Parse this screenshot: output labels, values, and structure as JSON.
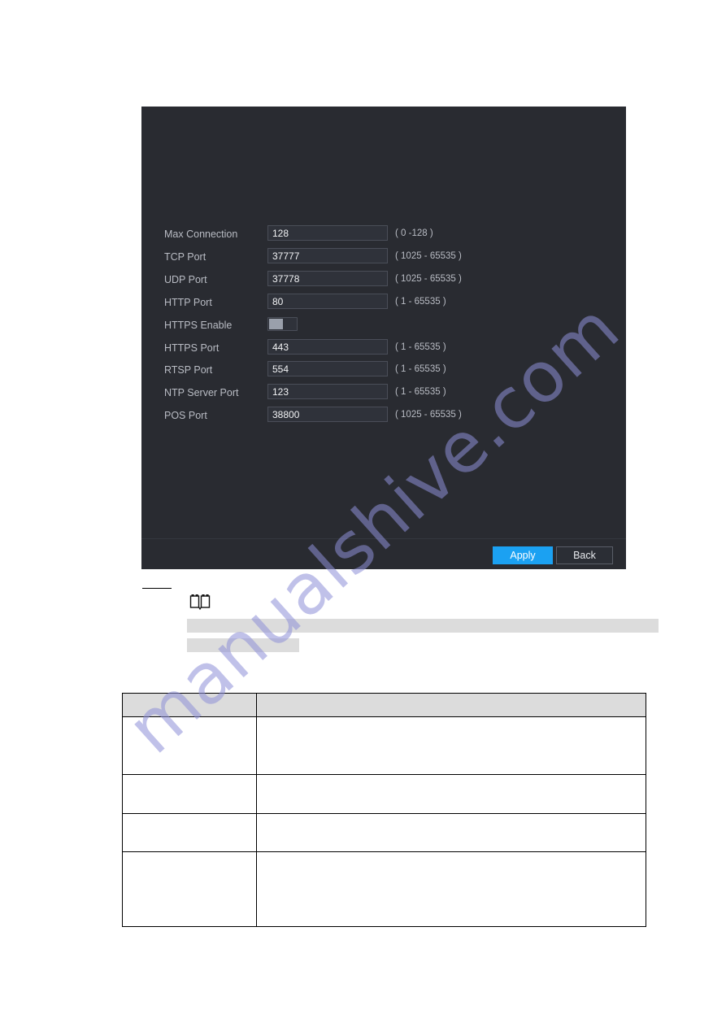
{
  "watermark": {
    "text": "manualshive.com",
    "color": "#8e90d8"
  },
  "dialog": {
    "background": "#292b31",
    "rows": [
      {
        "label": "Max Connection",
        "type": "input",
        "value": "128",
        "hint": "( 0 -128 )"
      },
      {
        "label": "TCP Port",
        "type": "input",
        "value": "37777",
        "hint": "( 1025 - 65535 )"
      },
      {
        "label": "UDP Port",
        "type": "input",
        "value": "37778",
        "hint": "( 1025 - 65535 )"
      },
      {
        "label": "HTTP Port",
        "type": "input",
        "value": "80",
        "hint": "( 1 - 65535 )"
      },
      {
        "label": "HTTPS Enable",
        "type": "toggle",
        "value": "off",
        "hint": ""
      },
      {
        "label": "HTTPS Port",
        "type": "input",
        "value": "443",
        "hint": "( 1 - 65535 )"
      },
      {
        "label": "RTSP Port",
        "type": "input",
        "value": "554",
        "hint": "( 1 - 65535 )"
      },
      {
        "label": "NTP Server Port",
        "type": "input",
        "value": "123",
        "hint": "( 1 - 65535 )"
      },
      {
        "label": "POS Port",
        "type": "input",
        "value": "38800",
        "hint": "( 1025 - 65535 )"
      }
    ],
    "footer": {
      "apply_label": "Apply",
      "back_label": "Back",
      "apply_color": "#1ba1f2"
    }
  },
  "note": {
    "icon": "open-book-icon",
    "redacted_lines": [
      "",
      ""
    ]
  },
  "spec_table": {
    "headers": [
      "",
      ""
    ],
    "rows": [
      [
        "",
        ""
      ],
      [
        "",
        ""
      ],
      [
        "",
        ""
      ],
      [
        "",
        ""
      ]
    ]
  }
}
